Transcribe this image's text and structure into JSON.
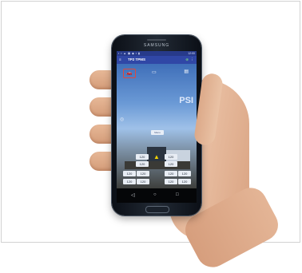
{
  "phone": {
    "brand": "SAMSUNG"
  },
  "status_bar": {
    "icons": "▪ ▪ ▲ ▣ ◆ ▪ ▮",
    "time": "12:00"
  },
  "app_bar": {
    "menu_glyph": "≡",
    "title": "TP2 TPMS",
    "action_a": "⊕",
    "action_b": "⋮"
  },
  "content": {
    "unit_label": "PSI",
    "center_button_label": "Menu",
    "icons": {
      "car": "car-icon",
      "tab": "tab-icon",
      "truck": "truck-icon",
      "warning": "warning-icon"
    },
    "tires": {
      "row1": [
        "120",
        "120"
      ],
      "row2": [
        "120",
        "120"
      ],
      "row3": [
        "120",
        "120",
        "120",
        "120"
      ],
      "row4": [
        "120",
        "120",
        "120",
        "120"
      ]
    }
  },
  "navbar": {
    "back": "◁",
    "home": "○",
    "recent": "□"
  },
  "colors": {
    "app_bar": "#3047a6",
    "status_bar": "#273a8a",
    "alert_outline": "#e0483c",
    "warning": "#f2d200"
  }
}
